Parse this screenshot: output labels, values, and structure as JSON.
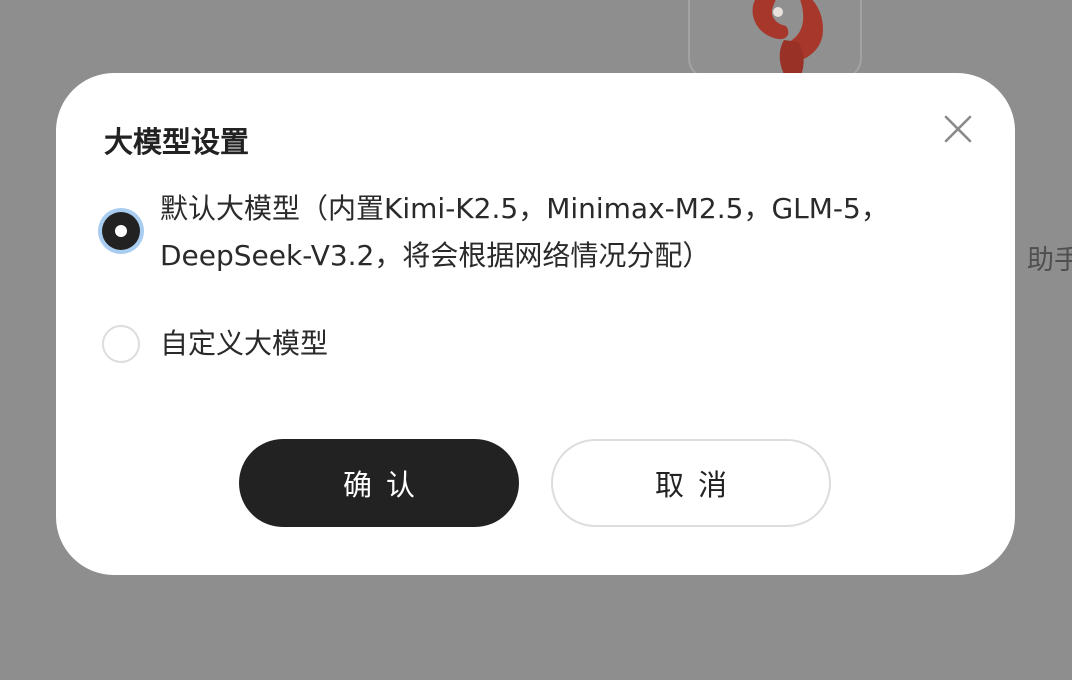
{
  "background": {
    "partial_text": "助手",
    "overlay_color": "#8e8e8e"
  },
  "dialog": {
    "title": "大模型设置",
    "close_icon": "close-icon",
    "options": [
      {
        "label": "默认大模型（内置Kimi-K2.5，Minimax-M2.5，GLM-5，DeepSeek-V3.2，将会根据网络情况分配）",
        "checked": true
      },
      {
        "label": "自定义大模型",
        "checked": false
      }
    ],
    "confirm_label": "确认",
    "cancel_label": "取消"
  },
  "colors": {
    "primary": "#222222",
    "focus_ring": "#a9cdf0",
    "border": "#dddddd"
  }
}
